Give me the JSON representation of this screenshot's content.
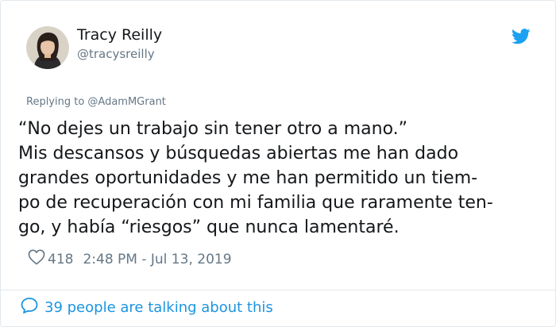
{
  "tweet": {
    "author_name": "Tracy Reilly",
    "author_handle": "@tracysreilly",
    "replying_to": "Replying to @AdamMGrant",
    "text_lines": [
      "“No dejes un trabajo sin tener otro a mano.”",
      "Mis descansos y búsquedas abiertas me han dado",
      "grandes oportunidades y me han permitido un tiem-",
      "po de recuperación con mi familia que raramente ten-",
      "go, y había “riesgos” que nunca lamentaré."
    ],
    "likes": "418",
    "timestamp": "2:48 PM - Jul 13, 2019",
    "talking": "39 people are talking about this"
  },
  "icons": {
    "brand": "twitter-bird-icon",
    "like": "heart-icon",
    "comment": "speech-bubble-icon"
  },
  "colors": {
    "accent": "#1da1f2",
    "link": "#1b95e0",
    "muted": "#657786",
    "text": "#14171a",
    "border": "#e1e8ed"
  }
}
